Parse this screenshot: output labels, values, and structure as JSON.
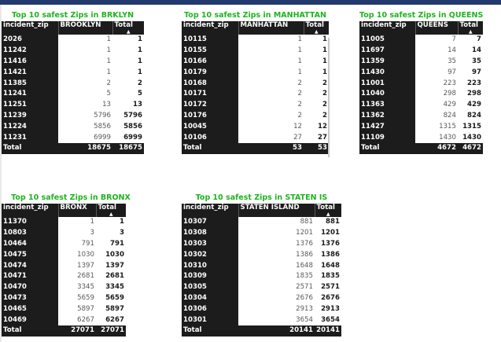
{
  "panels": {
    "brooklyn": {
      "title": "Top 10 safest Zips in BRKLYN",
      "columns": [
        "incident_zip",
        "BROOKLYN",
        "Total"
      ],
      "rows": [
        [
          "2026",
          "1",
          "1"
        ],
        [
          "11242",
          "1",
          "1"
        ],
        [
          "11416",
          "1",
          "1"
        ],
        [
          "11421",
          "1",
          "1"
        ],
        [
          "11385",
          "2",
          "2"
        ],
        [
          "11241",
          "5",
          "5"
        ],
        [
          "11251",
          "13",
          "13"
        ],
        [
          "11239",
          "5796",
          "5796"
        ],
        [
          "11224",
          "5856",
          "5856"
        ],
        [
          "11231",
          "6999",
          "6999"
        ]
      ],
      "total": [
        "Total",
        "18675",
        "18675"
      ]
    },
    "manhattan": {
      "title": "Top 10 safest Zips in MANHATTAN",
      "columns": [
        "incident_zip",
        "MANHATTAN",
        "Total"
      ],
      "rows": [
        [
          "10115",
          "1",
          "1"
        ],
        [
          "10155",
          "1",
          "1"
        ],
        [
          "10166",
          "1",
          "1"
        ],
        [
          "10179",
          "1",
          "1"
        ],
        [
          "10168",
          "2",
          "2"
        ],
        [
          "10171",
          "2",
          "2"
        ],
        [
          "10172",
          "2",
          "2"
        ],
        [
          "10176",
          "2",
          "2"
        ],
        [
          "10045",
          "12",
          "12"
        ],
        [
          "10106",
          "27",
          "27"
        ]
      ],
      "total": [
        "Total",
        "53",
        "53"
      ]
    },
    "queens": {
      "title": "Top 10 safest Zips in QUEENS",
      "columns": [
        "incident_zip",
        "QUEENS",
        "Total"
      ],
      "rows": [
        [
          "11005",
          "7",
          "7"
        ],
        [
          "11697",
          "14",
          "14"
        ],
        [
          "11359",
          "35",
          "35"
        ],
        [
          "11430",
          "97",
          "97"
        ],
        [
          "11001",
          "223",
          "223"
        ],
        [
          "11040",
          "298",
          "298"
        ],
        [
          "11363",
          "429",
          "429"
        ],
        [
          "11362",
          "824",
          "824"
        ],
        [
          "11427",
          "1315",
          "1315"
        ],
        [
          "11109",
          "1430",
          "1430"
        ]
      ],
      "total": [
        "Total",
        "4672",
        "4672"
      ]
    },
    "bronx": {
      "title": "Top 10 safest Zips in BRONX",
      "columns": [
        "incident_zip",
        "BRONX",
        "Total"
      ],
      "rows": [
        [
          "11370",
          "1",
          "1"
        ],
        [
          "10803",
          "3",
          "3"
        ],
        [
          "10464",
          "791",
          "791"
        ],
        [
          "10475",
          "1030",
          "1030"
        ],
        [
          "10474",
          "1397",
          "1397"
        ],
        [
          "10471",
          "2681",
          "2681"
        ],
        [
          "10470",
          "3345",
          "3345"
        ],
        [
          "10473",
          "5659",
          "5659"
        ],
        [
          "10465",
          "5897",
          "5897"
        ],
        [
          "10469",
          "6267",
          "6267"
        ]
      ],
      "total": [
        "Total",
        "27071",
        "27071"
      ]
    },
    "staten_is": {
      "title": "Top 10 safest Zips in STATEN IS",
      "columns": [
        "incident_zip",
        "STATEN ISLAND",
        "Total"
      ],
      "rows": [
        [
          "10307",
          "881",
          "881"
        ],
        [
          "10308",
          "1201",
          "1201"
        ],
        [
          "10303",
          "1376",
          "1376"
        ],
        [
          "10302",
          "1386",
          "1386"
        ],
        [
          "10310",
          "1648",
          "1648"
        ],
        [
          "10309",
          "1835",
          "1835"
        ],
        [
          "10305",
          "2571",
          "2571"
        ],
        [
          "10304",
          "2676",
          "2676"
        ],
        [
          "10306",
          "2913",
          "2913"
        ],
        [
          "10301",
          "3654",
          "3654"
        ]
      ],
      "total": [
        "Total",
        "20141",
        "20141"
      ]
    }
  },
  "colors": {
    "title": "#1fb41f",
    "header_bg": "#1c1c1c",
    "topbar": "#233a6e"
  },
  "sort_indicator_icon": "sort-ascending-icon"
}
